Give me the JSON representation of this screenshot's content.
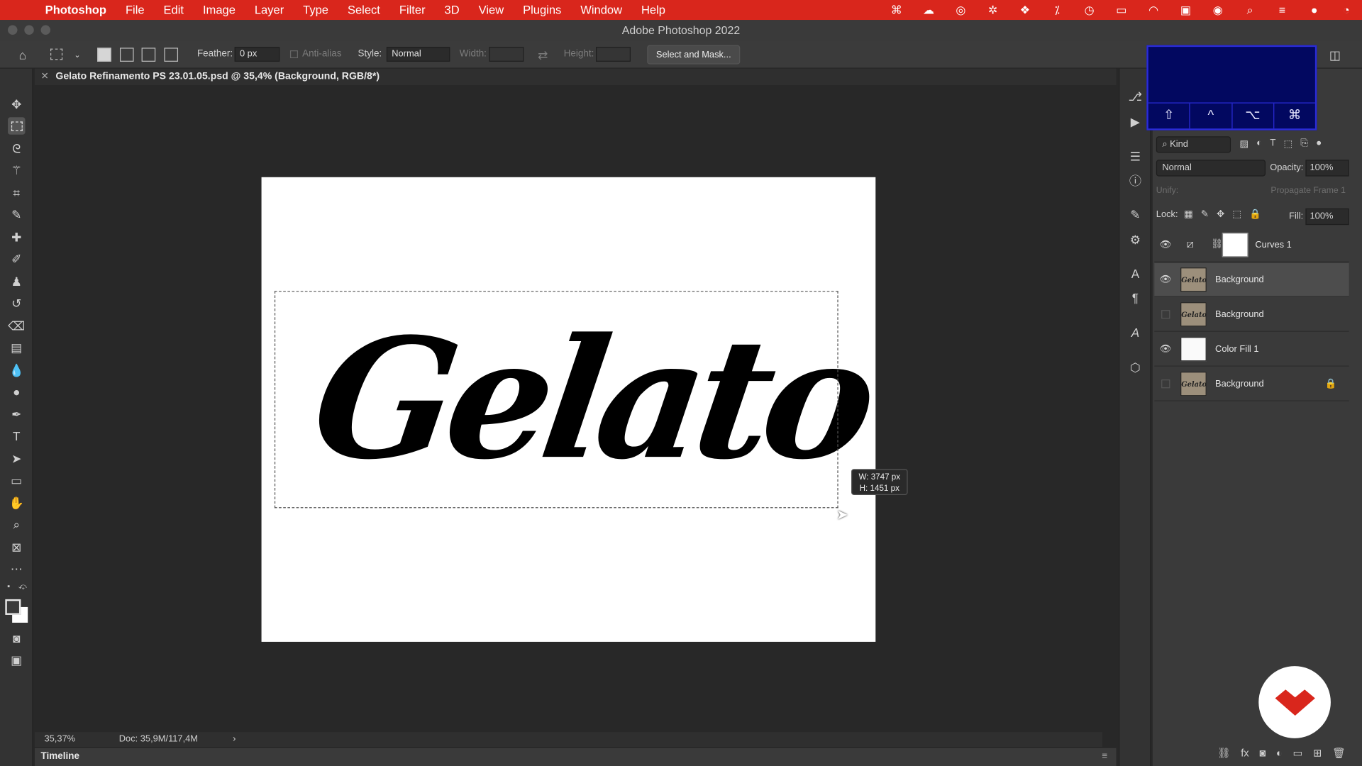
{
  "menubar": {
    "app": "Photoshop",
    "items": [
      "File",
      "Edit",
      "Image",
      "Layer",
      "Type",
      "Select",
      "Filter",
      "3D",
      "View",
      "Plugins",
      "Window",
      "Help"
    ],
    "status_icons": [
      "command-icon",
      "cloud-icon",
      "creative-cloud-icon",
      "gear-icon",
      "dropbox-icon",
      "magic-icon",
      "time-machine-icon",
      "battery-icon",
      "wifi-icon",
      "display-icon",
      "user-icon",
      "search-icon",
      "control-center-icon",
      "siri-icon",
      "clock-icon"
    ]
  },
  "window": {
    "title": "Adobe Photoshop 2022"
  },
  "options": {
    "feather_label": "Feather:",
    "feather_value": "0 px",
    "antialias_label": "Anti-alias",
    "style_label": "Style:",
    "style_value": "Normal",
    "width_label": "Width:",
    "height_label": "Height:",
    "select_mask_label": "Select and Mask..."
  },
  "document": {
    "tab_title": "Gelato Refinamento PS 23.01.05.psd @ 35,4% (Background, RGB/8*)",
    "artwork_text": "Gelato",
    "size_tip_w": "W: 3747 px",
    "size_tip_h": "H: 1451 px"
  },
  "statusbar": {
    "zoom": "35,37%",
    "doc_size": "Doc: 35,9M/117,4M",
    "arrow": "›"
  },
  "timeline": {
    "label": "Timeline"
  },
  "keys": [
    "⇧",
    "^",
    "⌥",
    "⌘"
  ],
  "layers": {
    "kind_label": "Kind",
    "blend_mode": "Normal",
    "opacity_label": "Opacity:",
    "opacity_value": "100%",
    "unify_label": "Unify:",
    "propagate_label": "Propagate Frame 1",
    "lock_label": "Lock:",
    "fill_label": "Fill:",
    "fill_value": "100%",
    "items": [
      {
        "name": "Curves 1",
        "visible": true
      },
      {
        "name": "Background",
        "visible": true,
        "selected": true,
        "thumb": "Gelato"
      },
      {
        "name": "Background",
        "visible": false,
        "thumb": "Gelato"
      },
      {
        "name": "Color Fill 1",
        "visible": true
      },
      {
        "name": "Background",
        "visible": false,
        "locked": true,
        "thumb": "Gelato"
      }
    ]
  },
  "colors": {
    "menubar": "#d9261c",
    "keys_overlay": "#020860",
    "badge_logo": "#d9261c"
  }
}
